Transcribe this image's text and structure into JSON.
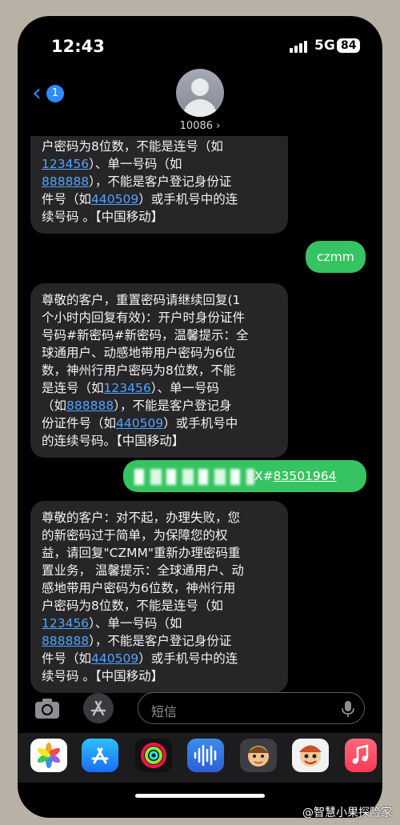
{
  "status_bar": {
    "time": "12:43",
    "network": "5G",
    "battery": "84"
  },
  "header": {
    "back_badge": "1",
    "contact": "10086 ›"
  },
  "messages": [
    {
      "l1": "户密码为8位数，不能是连号（如",
      "link1": "123456",
      "l2": "）、单一号码（如",
      "link2": "888888",
      "l3": "），不能是客户登记身份证",
      "l4a": "件号（如",
      "link3": "440509",
      "l4b": "）或手机号中的连",
      "l5": "续号码 。【中国移动】"
    },
    {
      "text": "czmm"
    },
    {
      "l1": "尊敬的客户，重置密码请继续回复(1",
      "l2": "个小时内回复有效)：开户时身份证件",
      "l3": "号码#新密码#新密码，温馨提示：全",
      "l4": "球通用户、动感地带用户密码为6位",
      "l5": "数，神州行用户密码为8位数，不能",
      "l6a": "是连号（如",
      "link1": "123456",
      "l6b": "）、单一号码",
      "l7a": "（如",
      "link2": "888888",
      "l7b": "），不能是客户登记身",
      "l8a": "份证件号（如",
      "link3": "440509",
      "l8b": "）或手机号中",
      "l9": "的连续号码。【中国移动】"
    },
    {
      "visible_suffix": "X#",
      "link": "83501964"
    },
    {
      "l1": "尊敬的客户：对不起，办理失败，您",
      "l2": "的新密码过于简单，为保障您的权",
      "l3": "益，请回复\"CZMM\"重新办理密码重",
      "l4": "置业务， 温馨提示：全球通用户、动",
      "l5": "感地带用户密码为6位数，神州行用",
      "l6": "户密码为8位数，不能是连号（如",
      "link1": "123456",
      "l7": "）、单一号码（如",
      "link2": "888888",
      "l8": "），不能是客户登记身份证",
      "l9a": "件号（如",
      "link3": "440509",
      "l9b": "）或手机号中的连",
      "l10": "续号码 。【中国移动】"
    }
  ],
  "input": {
    "placeholder": "短信"
  },
  "dock_apps": [
    "photos-app-icon",
    "app-store-icon",
    "fitness-activity-icon",
    "audio-app-icon",
    "memoji-app-icon",
    "memoji-stickers-icon",
    "music-app-icon"
  ],
  "watermark": "@智慧小果探险家",
  "colors": {
    "incoming": "#262628",
    "outgoing": "#35c461",
    "link": "#4ea4ff",
    "accent": "#2f8bff"
  }
}
